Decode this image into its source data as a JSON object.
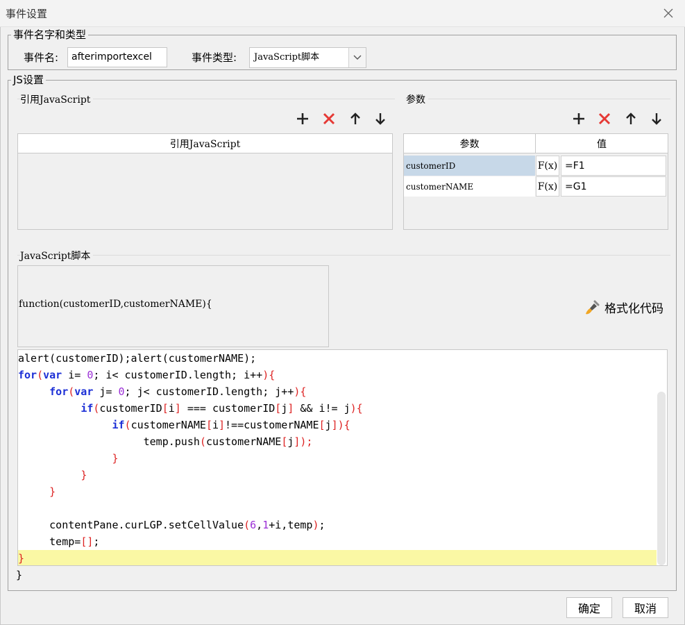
{
  "window": {
    "title": "事件设置"
  },
  "name_group": {
    "legend": "事件名字和类型",
    "name_label": "事件名:",
    "name_value": "afterimportexcel",
    "type_label": "事件类型:",
    "type_value": "JavaScript脚本"
  },
  "js_group": {
    "legend": "JS设置",
    "ref_section": {
      "title": "引用JavaScript",
      "column": "引用JavaScript"
    },
    "params_section": {
      "title": "参数",
      "columns": [
        "参数",
        "值"
      ],
      "rows": [
        {
          "name": "customerID",
          "formula": "F(x)",
          "value": "=F1"
        },
        {
          "name": "customerNAME",
          "formula": "F(x)",
          "value": "=G1"
        }
      ]
    },
    "script_section": {
      "title": "JavaScript脚本",
      "signature": "function(customerID,customerNAME){",
      "format_label": "格式化代码",
      "closing": "}"
    }
  },
  "code_lines": [
    "alert(customerID);alert(customerNAME);",
    "for(var i= 0; i< customerID.length; i++){",
    "     for(var j= 0; j< customerID.length; j++){",
    "          if(customerID[i] === customerID[j] && i!= j){",
    "               if(customerNAME[i]!==customerNAME[j]){",
    "                    temp.push(customerNAME[j]);",
    "               }",
    "          }",
    "     }",
    "",
    "     contentPane.curLGP.setCellValue(6,1+i,temp);",
    "     temp=[];",
    "}"
  ],
  "toolbar_icons": [
    "plus-icon",
    "delete-x-icon",
    "arrow-up-icon",
    "arrow-down-icon"
  ],
  "colors": {
    "selected_row": "#c7d8e8",
    "current_line": "#faf8a4",
    "keyword": "#1c2fd6",
    "bracket": "#d22222",
    "delete_icon": "#e53935",
    "number": "#9b2fd6"
  },
  "buttons": {
    "ok": "确定",
    "cancel": "取消"
  }
}
